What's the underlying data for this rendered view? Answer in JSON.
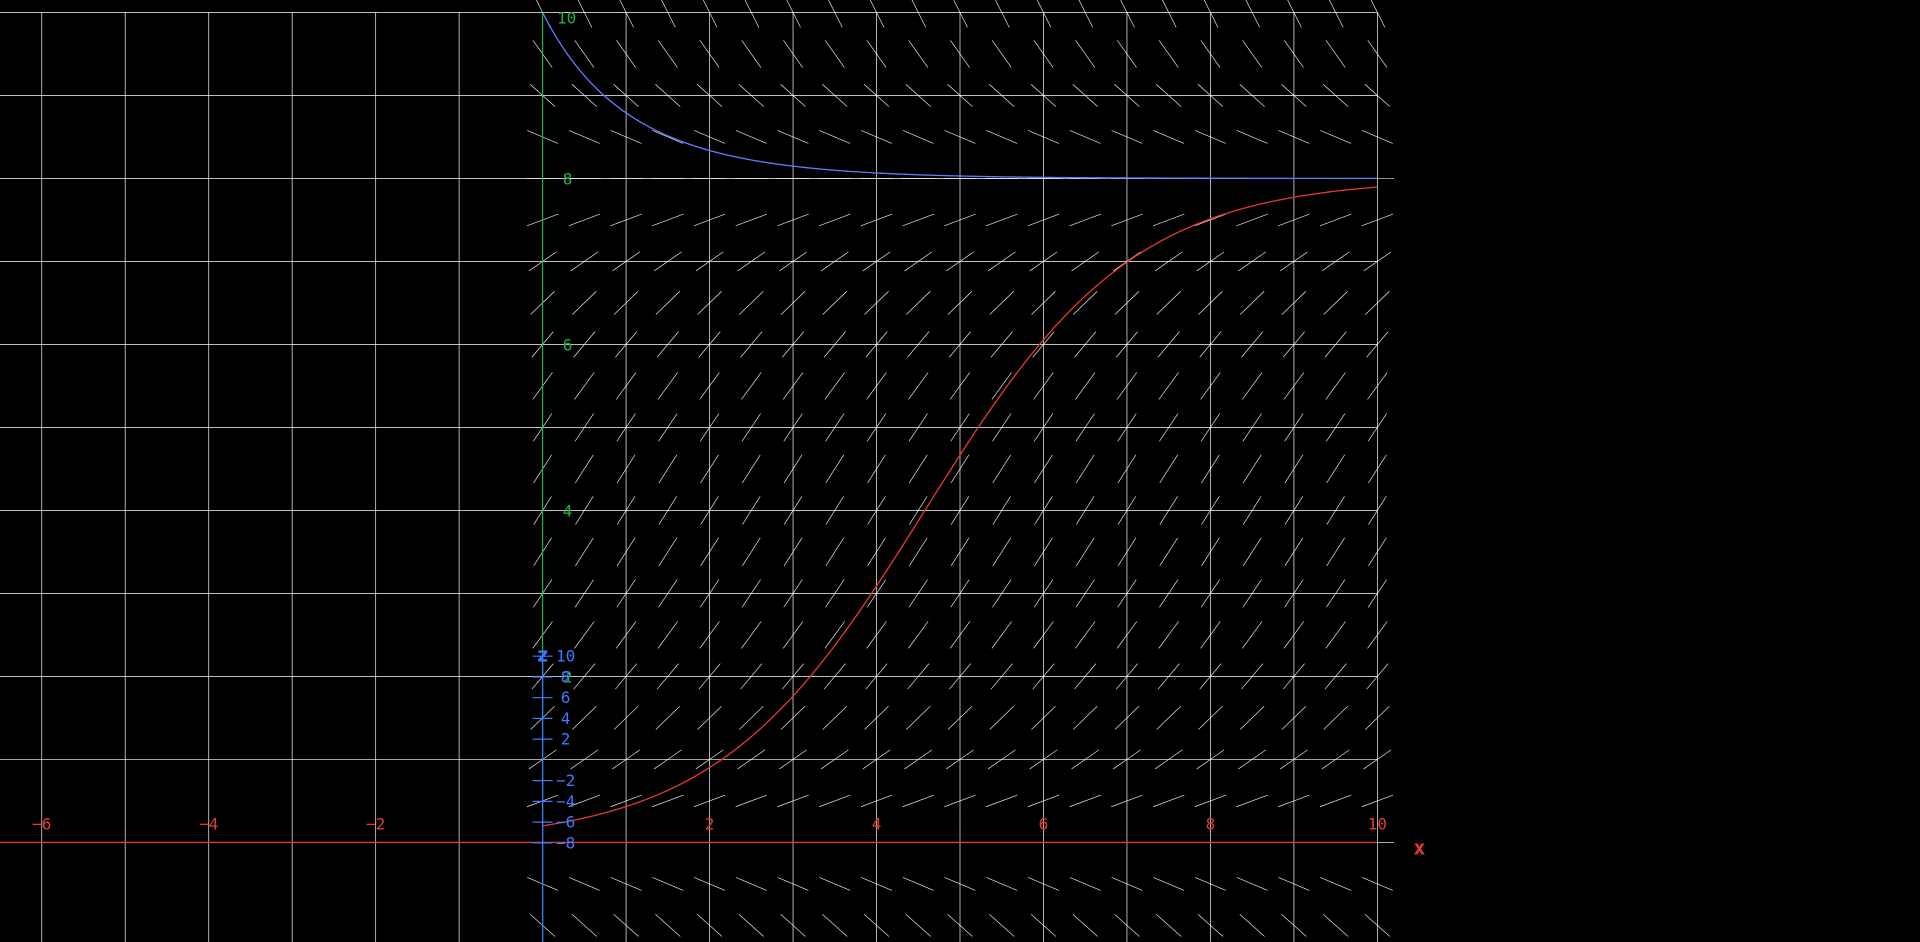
{
  "chart_data": {
    "type": "line",
    "title": "",
    "view": {
      "x": [
        -6.5,
        16.5
      ],
      "y": [
        -1.2,
        10.15
      ]
    },
    "grid": {
      "x_from": -6,
      "x_to": 10,
      "y_from": 0,
      "y_to": 10,
      "step_x": 1,
      "step_y": 1
    },
    "axes": {
      "x": {
        "label": "x",
        "range": [
          -6.5,
          10
        ],
        "ticks": [
          "−6",
          "−4",
          "−2",
          "2",
          "4",
          "6",
          "8",
          "10"
        ],
        "tick_values": [
          -6,
          -4,
          -2,
          2,
          4,
          6,
          8,
          10
        ]
      },
      "y": {
        "label": "",
        "range": [
          -1.2,
          10
        ],
        "ticks": [
          "2",
          "4",
          "6",
          "8",
          "10"
        ],
        "tick_values": [
          2,
          4,
          6,
          8,
          10
        ]
      },
      "z": {
        "label": "z",
        "ticks": [
          "10",
          "8",
          "6",
          "4",
          "2",
          "−2",
          "−4",
          "−6",
          "−8"
        ],
        "tick_values": [
          10,
          8,
          6,
          4,
          2,
          -2,
          -4,
          -6,
          -8
        ],
        "scale_y_per_unit": 0.125,
        "origin_y": 1.0
      }
    },
    "slope_field": {
      "equation": "dy/dx = 0.8·y·(1 − y/8)",
      "x_from": 0,
      "x_to": 10,
      "y_from": -1.5,
      "y_to": 10,
      "step": 0.5,
      "segment_half_length": 0.2
    },
    "series": [
      {
        "color": "#e53935",
        "y0": 0.2,
        "r": 0.8,
        "K": 8,
        "x_range": [
          0,
          10
        ]
      },
      {
        "color": "#5b7fff",
        "y0": 10,
        "r": 0.8,
        "K": 8,
        "x_range": [
          0,
          10
        ]
      }
    ],
    "colors": {
      "background": "#000000",
      "grid": "#ffffff",
      "x_axis": "#e53935",
      "y_axis": "#22b14c",
      "z_axis": "#3a7bff",
      "slope": "#ffffff"
    }
  }
}
